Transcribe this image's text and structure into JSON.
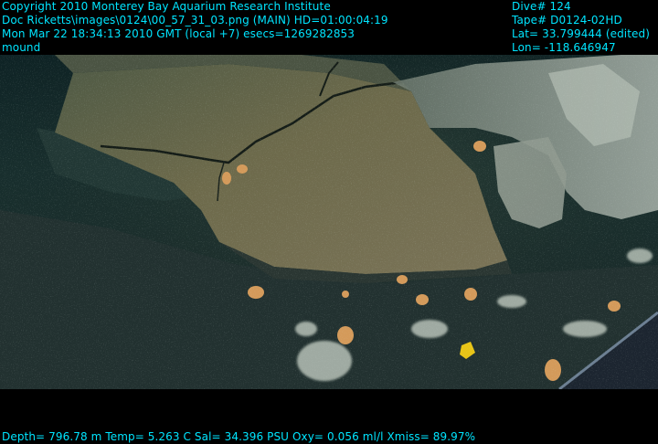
{
  "overlay": {
    "left_lines": [
      "Copyright 2010 Monterey Bay Aquarium Research Institute",
      "Doc Ricketts\\images\\0124\\00_57_31_03.png (MAIN)  HD=01:00:04:19",
      "Mon Mar 22 18:34:13 2010 GMT (local +7)  esecs=1269282853",
      "mound"
    ],
    "right_lines": [
      "Dive# 124",
      "Tape# D0124-02HD",
      "Lat= 33.799444 (edited)",
      "Lon= -118.646947"
    ],
    "footer": "Depth= 796.78 m  Temp= 5.263 C  Sal= 34.396 PSU  Oxy= 0.056 ml/l  Xmiss= 89.97%"
  },
  "colors": {
    "overlay_text": "#00e5ff",
    "background": "#000000",
    "water": "#0f2a2c",
    "rock": "#6b6446",
    "sediment": "#233232"
  }
}
